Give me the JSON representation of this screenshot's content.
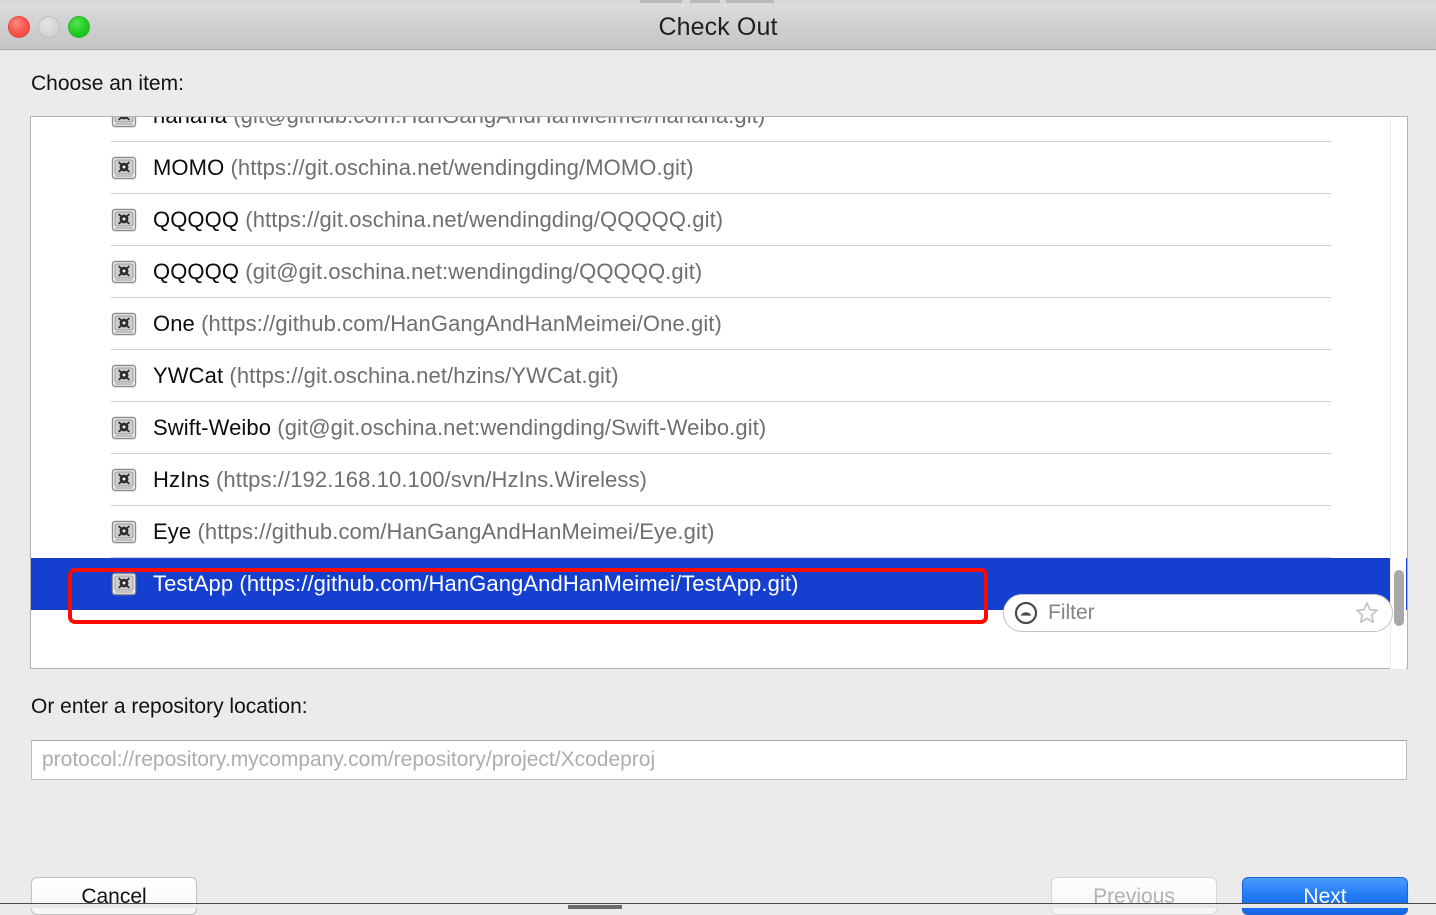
{
  "window": {
    "title": "Check Out",
    "traffic_lights": [
      "close-red",
      "minimize-yellow",
      "zoom-green"
    ]
  },
  "labels": {
    "choose_item": "Choose an item:",
    "repository_location": "Or enter a repository location:"
  },
  "list": {
    "items": [
      {
        "name": "hahaha",
        "url": "(git@github.com:HanGangAndHanMeimei/hahaha.git)",
        "selected": false,
        "clipped": true
      },
      {
        "name": "MOMO",
        "url": "(https://git.oschina.net/wendingding/MOMO.git)",
        "selected": false
      },
      {
        "name": "QQQQQ",
        "url": "(https://git.oschina.net/wendingding/QQQQQ.git)",
        "selected": false
      },
      {
        "name": "QQQQQ",
        "url": "(git@git.oschina.net:wendingding/QQQQQ.git)",
        "selected": false
      },
      {
        "name": "One",
        "url": "(https://github.com/HanGangAndHanMeimei/One.git)",
        "selected": false
      },
      {
        "name": "YWCat",
        "url": "(https://git.oschina.net/hzins/YWCat.git)",
        "selected": false
      },
      {
        "name": "Swift-Weibo",
        "url": "(git@git.oschina.net:wendingding/Swift-Weibo.git)",
        "selected": false
      },
      {
        "name": "HzIns",
        "url": "(https://192.168.10.100/svn/HzIns.Wireless)",
        "selected": false
      },
      {
        "name": "Eye",
        "url": "(https://github.com/HanGangAndHanMeimei/Eye.git)",
        "selected": false
      },
      {
        "name": "TestApp",
        "url": "(https://github.com/HanGangAndHanMeimei/TestApp.git)",
        "selected": true
      }
    ],
    "icon": "repository-vault-icon",
    "selection_color": "#1540cf",
    "scrollbar": {
      "orientation": "vertical",
      "thumb_position": "near-bottom"
    }
  },
  "filter": {
    "placeholder": "Filter",
    "value": "",
    "left_icon": "filter-funnel-icon",
    "right_icon": "star-outline-icon"
  },
  "repository_field": {
    "placeholder": "protocol://repository.mycompany.com/repository/project/Xcodeproj",
    "value": ""
  },
  "buttons": {
    "cancel": "Cancel",
    "previous": "Previous",
    "next": "Next",
    "previous_disabled": true,
    "next_accent_color": "#2079f3"
  },
  "annotation": {
    "shape": "rectangle",
    "color": "#f90c04",
    "target": "TestApp list row"
  }
}
